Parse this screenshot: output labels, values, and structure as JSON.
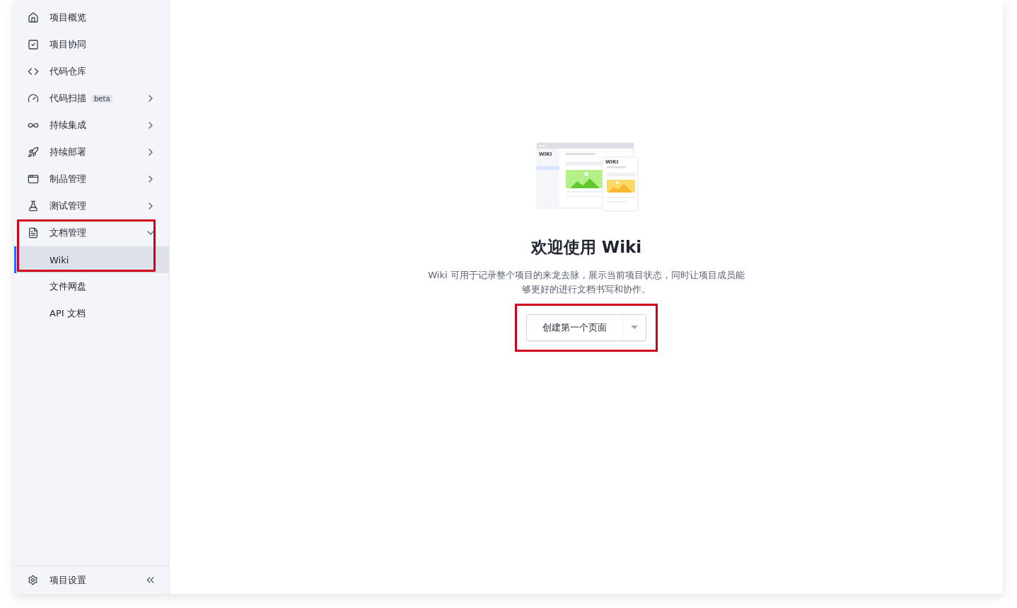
{
  "sidebar": {
    "items": [
      {
        "label": "项目概览",
        "kind": "home",
        "highlighted": false
      },
      {
        "label": "项目协同",
        "kind": "check-square",
        "highlighted": false
      },
      {
        "label": "代码仓库",
        "kind": "code",
        "highlighted": false
      },
      {
        "label": "代码扫描",
        "kind": "scan",
        "badge": "beta",
        "expanded": false,
        "highlighted": false
      },
      {
        "label": "持续集成",
        "kind": "infinity",
        "expanded": false,
        "highlighted": false
      },
      {
        "label": "持续部署",
        "kind": "rocket",
        "expanded": false,
        "highlighted": false
      },
      {
        "label": "制品管理",
        "kind": "archive",
        "expanded": false,
        "highlighted": false
      },
      {
        "label": "测试管理",
        "kind": "flask",
        "expanded": false,
        "highlighted": false
      },
      {
        "label": "文档管理",
        "kind": "document",
        "expanded": true,
        "highlighted": true,
        "children": [
          {
            "label": "Wiki",
            "selected": true
          },
          {
            "label": "文件网盘",
            "selected": false
          },
          {
            "label": "API 文档",
            "selected": false
          }
        ]
      }
    ],
    "footer": {
      "label": "项目设置"
    }
  },
  "empty_state": {
    "illustration": {
      "labels": [
        "WIKI",
        "WIKI"
      ]
    },
    "title": "欢迎使用 Wiki",
    "description": "Wiki 可用于记录整个项目的来龙去脉，展示当前项目状态，同时让项目成员能够更好的进行文档书写和协作。",
    "button": {
      "label": "创建第一个页面",
      "highlighted": true
    }
  }
}
